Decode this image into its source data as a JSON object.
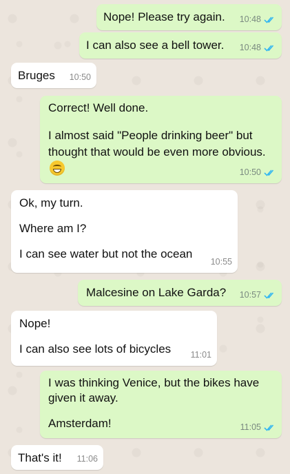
{
  "messages": [
    {
      "dir": "out",
      "lines": [
        "Nope! Please try again."
      ],
      "time": "10:48",
      "ticks": true
    },
    {
      "dir": "out",
      "lines": [
        "I can also see a bell tower."
      ],
      "time": "10:48",
      "ticks": true
    },
    {
      "dir": "in",
      "lines": [
        "Bruges"
      ],
      "time": "10:50",
      "ticks": false
    },
    {
      "dir": "out",
      "lines": [
        "Correct! Well done.",
        "I almost said \"People drinking beer\" but thought that would be even more obvious."
      ],
      "time": "10:50",
      "ticks": true,
      "emoji": "grinning-face-emoji"
    },
    {
      "dir": "in",
      "lines": [
        "Ok, my turn.",
        "Where am I?",
        "I can see water but not the ocean"
      ],
      "time": "10:55",
      "ticks": false
    },
    {
      "dir": "out",
      "lines": [
        "Malcesine on Lake Garda?"
      ],
      "time": "10:57",
      "ticks": true
    },
    {
      "dir": "in",
      "lines": [
        "Nope!",
        "I can also see lots of bicycles"
      ],
      "time": "11:01",
      "ticks": false
    },
    {
      "dir": "out",
      "lines": [
        "I was thinking Venice, but the bikes have given it away.",
        "Amsterdam!"
      ],
      "time": "11:05",
      "ticks": true
    },
    {
      "dir": "in",
      "lines": [
        "That's it!"
      ],
      "time": "11:06",
      "ticks": false
    }
  ],
  "colors": {
    "outgoing": "#dcf8c6",
    "incoming": "#ffffff",
    "read_ticks": "#34b7f1",
    "background": "#ece5dd"
  },
  "icons": {
    "read_receipt": "double-check-icon"
  }
}
